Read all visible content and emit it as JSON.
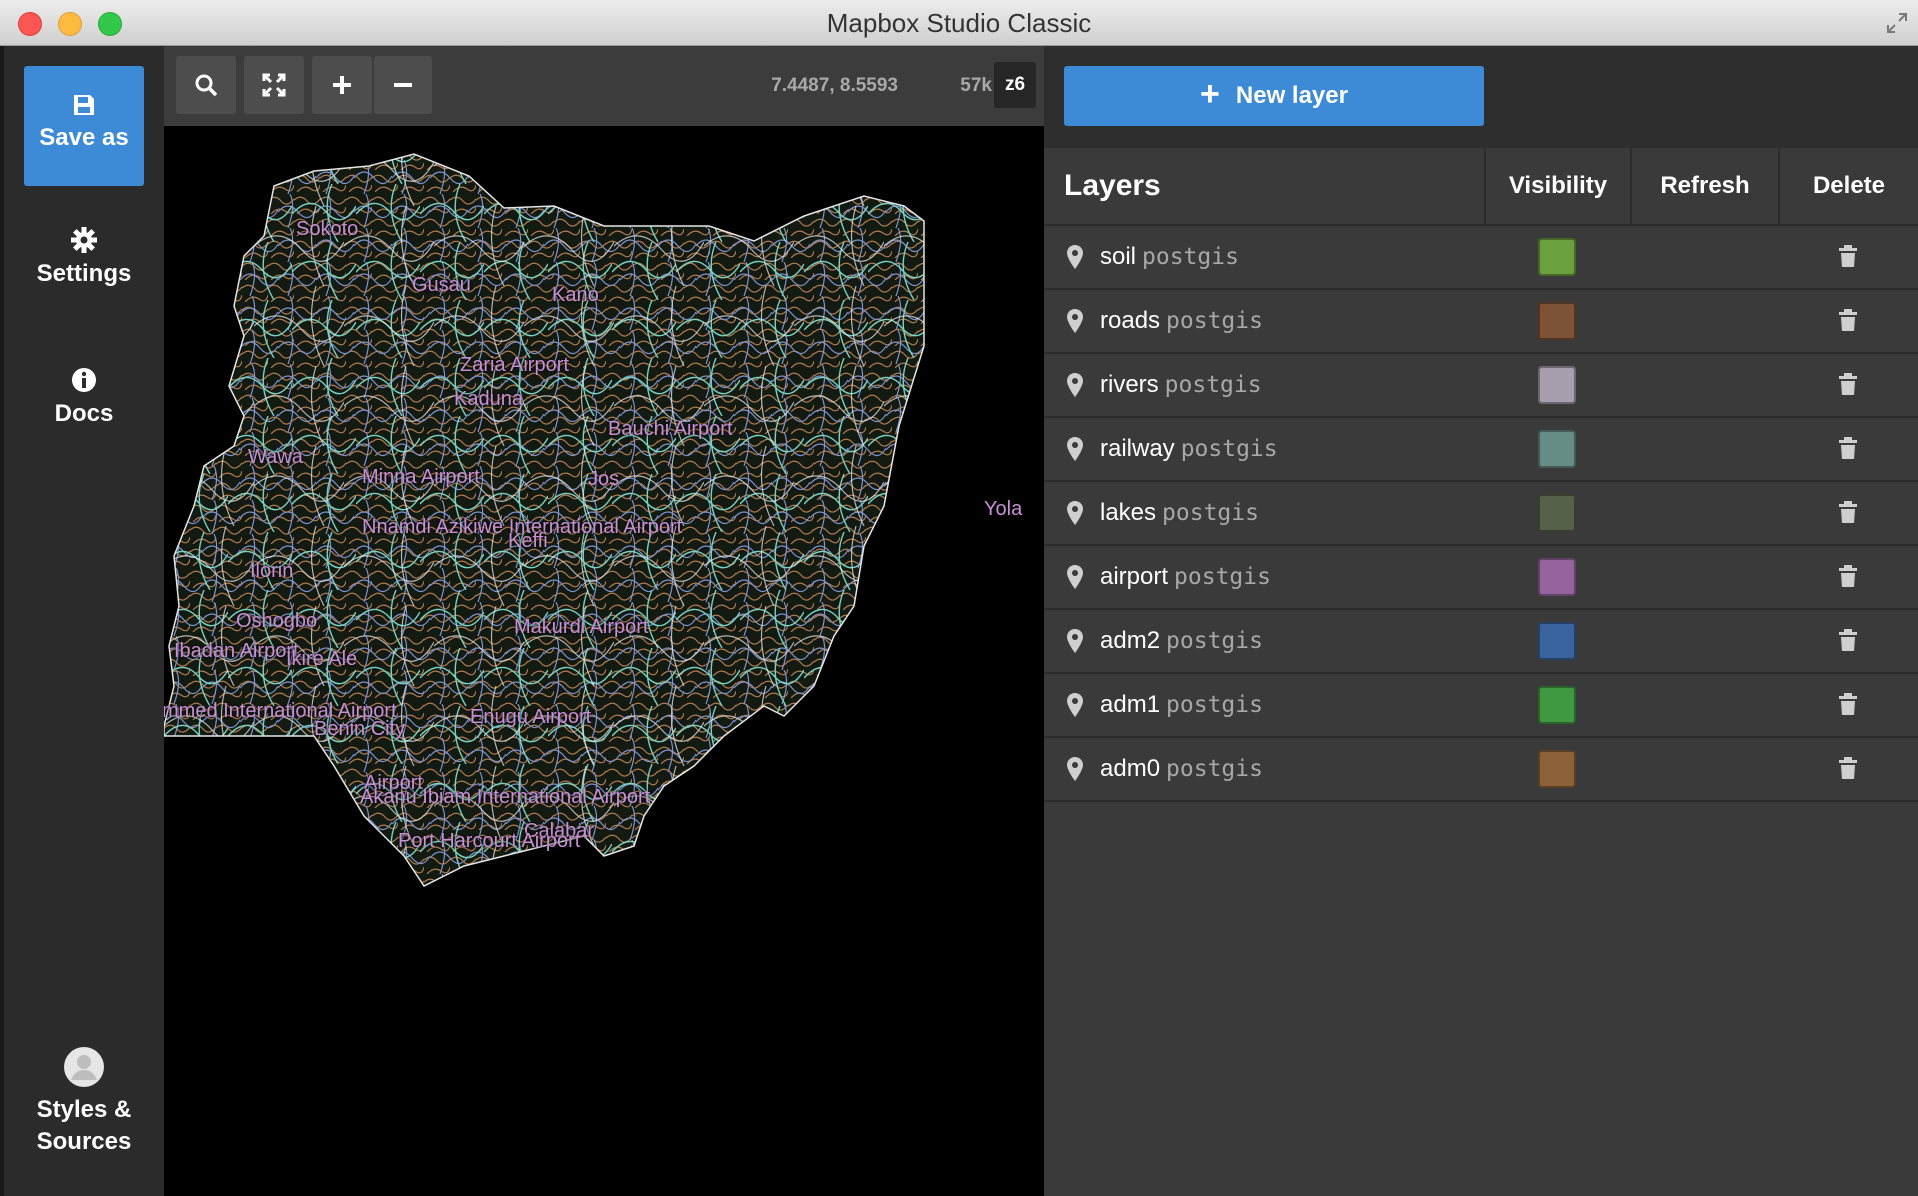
{
  "window": {
    "title": "Mapbox Studio Classic"
  },
  "sidebar": {
    "save_label": "Save as",
    "settings_label": "Settings",
    "docs_label": "Docs",
    "styles_line1": "Styles &",
    "styles_line2": "Sources"
  },
  "map": {
    "coordinates": "7.4487, 8.5593",
    "feature_count": "57k",
    "zoom": "z6",
    "labels": [
      "Sokoto",
      "Gusau",
      "Kano",
      "Zaria Airport",
      "Kaduna",
      "Bauchi Airport",
      "Wawa",
      "Minna Airport",
      "Jos",
      "Yola",
      "Nnamdi Azikiwe International Airport",
      "Keffi",
      "Ilorin",
      "Oshogbo",
      "Ibadan Airport",
      "Ikire Ale",
      "Makurdi Airport",
      "mmed International Airport",
      "Benin City",
      "Enugu Airport",
      "Airport",
      "Akanu Ibiam International Airport",
      "Calabar",
      "Port Harcourt Airport"
    ]
  },
  "panel": {
    "new_layer_label": "New layer",
    "header": {
      "layers": "Layers",
      "visibility": "Visibility",
      "refresh": "Refresh",
      "delete": "Delete"
    },
    "layers": [
      {
        "name": "soil",
        "source": "postgis",
        "color": "#6aa03d"
      },
      {
        "name": "roads",
        "source": "postgis",
        "color": "#7d5236"
      },
      {
        "name": "rivers",
        "source": "postgis",
        "color": "#a89fae"
      },
      {
        "name": "railway",
        "source": "postgis",
        "color": "#668d85"
      },
      {
        "name": "lakes",
        "source": "postgis",
        "color": "#56614a"
      },
      {
        "name": "airport",
        "source": "postgis",
        "color": "#95649c"
      },
      {
        "name": "adm2",
        "source": "postgis",
        "color": "#3a64a0"
      },
      {
        "name": "adm1",
        "source": "postgis",
        "color": "#3f9940"
      },
      {
        "name": "adm0",
        "source": "postgis",
        "color": "#8d6239"
      }
    ]
  },
  "icons": {
    "save": "floppy-disk-icon",
    "settings": "gear-icon",
    "docs": "info-icon",
    "styles": "user-avatar-icon",
    "search": "search-icon",
    "fit": "expand-icon",
    "zoom_in": "plus-icon",
    "zoom_out": "minus-icon",
    "layer": "map-pin-icon",
    "delete": "trash-icon"
  }
}
